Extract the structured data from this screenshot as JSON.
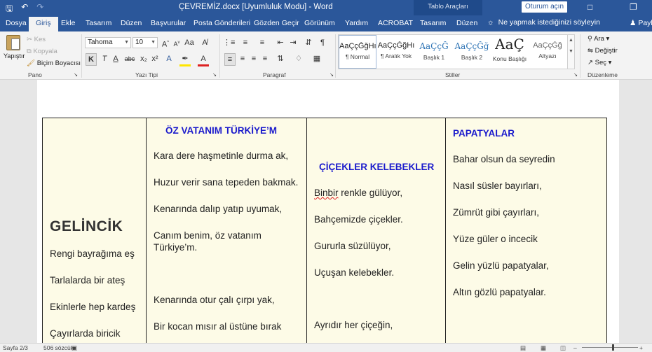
{
  "titlebar": {
    "save_icon": "save-icon",
    "undo_icon": "undo-icon",
    "redo_icon": "redo-icon",
    "document_title": "ÇEVREMİZ.docx [Uyumluluk Modu]  -  Word",
    "context_label": "Tablo Araçları",
    "sign_in": "Oturum açın",
    "restore_icon": "restore-icon"
  },
  "tabs": {
    "file": "Dosya",
    "home": "Giriş",
    "insert": "Ekle",
    "design": "Tasarım",
    "layout": "Düzen",
    "references": "Başvurular",
    "mailings": "Posta Gönderileri",
    "review": "Gözden Geçir",
    "view": "Görünüm",
    "help": "Yardım",
    "acrobat": "ACROBAT",
    "table_design": "Tasarım",
    "table_layout": "Düzen",
    "tell_me": "Ne yapmak istediğinizi söyleyin",
    "share": "Payl"
  },
  "ribbon": {
    "clipboard": {
      "paste": "Yapıştır",
      "cut": "Kes",
      "copy": "Kopyala",
      "format_painter": "Biçim Boyacısı",
      "group": "Pano"
    },
    "font": {
      "font_name": "Tahoma",
      "font_size": "10",
      "bold": "K",
      "italic": "T",
      "underline": "A",
      "strike": "abc",
      "subscript": "x₂",
      "superscript": "x²",
      "group": "Yazı Tipi"
    },
    "paragraph": {
      "group": "Paragraf",
      "pilcrow": "¶"
    },
    "styles": {
      "group": "Stiller",
      "items": [
        {
          "sample": "AaÇçĞğHı",
          "name": "¶ Normal"
        },
        {
          "sample": "AaÇçĞğHı",
          "name": "¶ Aralık Yok"
        },
        {
          "sample": "AaÇçĞ",
          "name": "Başlık 1"
        },
        {
          "sample": "AaÇçĞğ",
          "name": "Başlık 2"
        },
        {
          "sample": "AaÇ",
          "name": "Konu Başlığı"
        },
        {
          "sample": "AaÇçĞğ",
          "name": "Altyazı"
        }
      ]
    },
    "editing": {
      "find": "Ara",
      "replace": "Değiştir",
      "select": "Seç",
      "group": "Düzenleme"
    }
  },
  "document": {
    "col1": {
      "title": "GELİNCİK",
      "lines": [
        "Rengi bayrağıma eş",
        "Tarlalarda bir ateş",
        "Ekinlerle hep kardeş",
        "Çayırlarda biricik"
      ]
    },
    "col2": {
      "title": "ÖZ VATANIM TÜRKİYE’M",
      "lines": [
        "Kara dere haşmetinle durma ak,",
        "Huzur verir sana tepeden bakmak.",
        "Kenarında dalıp yatıp uyumak,",
        "Canım benim, öz vatanım Türkiye’m.",
        "Kenarında otur çalı çırpı yak,",
        "Bir kocan mısır al üstüne bırak"
      ]
    },
    "col3": {
      "title": "ÇİÇEKLER KELEBEKLER",
      "lines": [
        "Binbir renkle gülüyor,",
        "Bahçemizde çiçekler.",
        "Gururla süzülüyor,",
        "Uçuşan kelebekler.",
        "Ayrıdır her çiçeğin,"
      ]
    },
    "col4": {
      "title": "PAPATYALAR",
      "lines": [
        "Bahar olsun da seyredin",
        "Nasıl süsler bayırları,",
        "Zümrüt gibi çayırları,",
        "Yüze güler o incecik",
        "Gelin yüzlü papatyalar,",
        "Altın gözlü papatyalar."
      ]
    }
  },
  "statusbar": {
    "page": "Sayfa 2/3",
    "words": "506 sözcük",
    "zoom": "%100"
  }
}
